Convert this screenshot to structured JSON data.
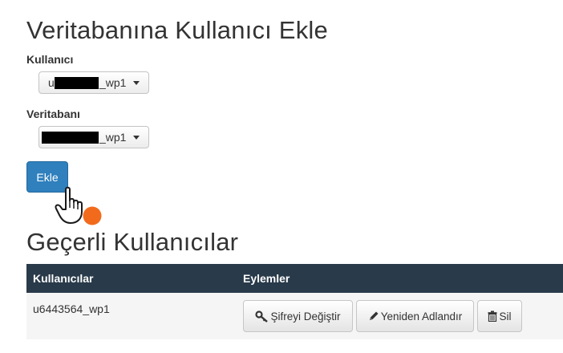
{
  "add_section": {
    "title": "Veritabanına Kullanıcı Ekle",
    "user_label": "Kullanıcı",
    "user_select": {
      "prefix": "u",
      "suffix": "_wp1"
    },
    "db_label": "Veritabanı",
    "db_select": {
      "suffix": "_wp1"
    },
    "add_button": "Ekle"
  },
  "current_section": {
    "title": "Geçerli Kullanıcılar",
    "columns": [
      "Kullanıcılar",
      "Eylemler"
    ],
    "rows": [
      {
        "user": "u6443564_wp1",
        "actions": {
          "change_password": "Şifreyi Değiştir",
          "rename": "Yeniden Adlandır",
          "delete": "Sil"
        }
      }
    ]
  },
  "icons": {
    "cursor": "hand-pointer-icon",
    "click_marker": "orange-dot",
    "key": "key-icon",
    "pencil": "pencil-icon",
    "trash": "trash-icon"
  },
  "colors": {
    "primary_button": "#2f80bd",
    "table_header": "#293a4a",
    "click_marker": "#f26b1d"
  }
}
